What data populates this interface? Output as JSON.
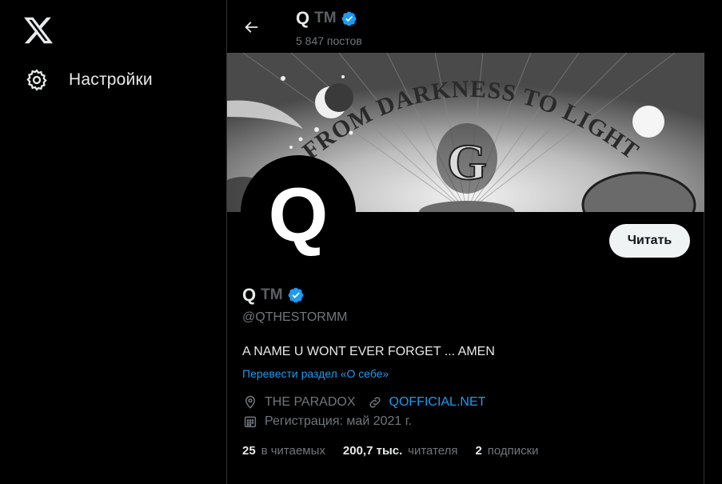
{
  "sidebar": {
    "logo_icon": "x-logo-icon",
    "items": [
      {
        "label": "Настройки",
        "icon": "gear-icon"
      }
    ]
  },
  "header": {
    "name": "Q",
    "suffix": "TM",
    "posts_count": "5 847 постов"
  },
  "banner": {
    "text": "FROM DARKNESS TO LIGHT",
    "letter": "G"
  },
  "profile": {
    "avatar_letter": "Q",
    "name": "Q",
    "suffix": "TM",
    "handle": "@QTHESTORMM",
    "bio": "A NAME U WONT EVER FORGET ... AMEN",
    "translate_label": "Перевести раздел «О себе»",
    "location": "THE PARADOX",
    "website": "QOFFICIAL.NET",
    "joined": "Регистрация: май 2021 г.",
    "follow_label": "Читать"
  },
  "stats": [
    {
      "value": "25",
      "label": "в читаемых"
    },
    {
      "value": "200,7 тыс.",
      "label": "читателя"
    },
    {
      "value": "2",
      "label": "подписки"
    }
  ],
  "colors": {
    "background": "#000000",
    "accent": "#1d9bf0",
    "muted": "#71767b",
    "text": "#e7e9ea",
    "border": "#2f3336"
  }
}
